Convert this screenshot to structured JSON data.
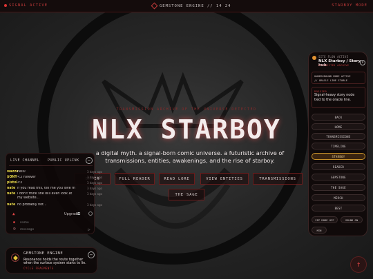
{
  "topbar": {
    "signal": "SIGNAL ACTIVE",
    "engine": "GEMSTONE ENGINE // 14 24",
    "mode": "STARBOY MODE"
  },
  "hero": {
    "subtitle": "TRANSMISSION ARCHIVE OF THE UNIVERSE DETECTED",
    "title": "NLX STARBOY",
    "desc_line1": "a digital myth. a signal-born comic universe. a futuristic archive of",
    "desc_line2": "transmissions, entities, awakenings, and the rise of starboy.",
    "buttons": [
      "ENTER",
      "FULL READER",
      "READ LORE",
      "VIEW ENTITIES",
      "TRANSMISSIONS",
      "THE SAGE"
    ]
  },
  "live": {
    "tab_live": "LIVE CHANNEL",
    "tab_public": "PUBLIC UPLINK",
    "close": "−",
    "messages": [
      {
        "user": "wazza",
        "text": "hell0",
        "time": "3 days ago"
      },
      {
        "user": "$ONY",
        "text": "<3 Forever",
        "time": "3 days ago"
      },
      {
        "user": "pistol",
        "text": "<3",
        "time": "3 days ago"
      },
      {
        "user": "nate",
        "text": "if you read this, tell me you love me.",
        "time": "3 days ago"
      },
      {
        "user": "nate",
        "text": "i don't think she will even look at my website...",
        "time": "3 days ago"
      },
      {
        "user": "nate",
        "text": "no probably not...",
        "time": "3 days ago"
      }
    ],
    "upgrade": "Upgrade",
    "name_placeholder": "name",
    "message_placeholder": "message"
  },
  "gem": {
    "title": "GEMSTONE ENGINE",
    "desc": "Resonance holds the route together when the surface system starts to lie.",
    "desc1": "Resonance holds the route together",
    "desc2": "when the surface system starts to lie.",
    "footer": "CYCLE FRAGMENTS",
    "close": "−"
  },
  "side": {
    "flow": "SITE FLOW ACTIVE",
    "hub": "NLX Starboy / Story hub",
    "restricted": "RESTRICTED ARCHIVE",
    "close": "×",
    "mode_line1": "UNDERGROUND MODE ACTIVE",
    "mode_line2": "// ORACLE LINE STABLE",
    "dossier_key": "DOSSIER",
    "dossier_line1": "Signal-heavy story node",
    "dossier_line2": "tied to the oracle line.",
    "nav": [
      "BACK",
      "HOME",
      "TRANSMISSIONS",
      "TIMELINE",
      "STARBOY",
      "READER",
      "GEMSTONE",
      "THE SAGE",
      "MERCH",
      "BEST"
    ],
    "vip": "VIP MODE OFF",
    "sound": "SOUND ON",
    "min": "MIN"
  },
  "scroll_top": "↑",
  "colors": {
    "accent": "#c23a3a",
    "gold": "#c8922a",
    "user": "#e8d84a"
  }
}
